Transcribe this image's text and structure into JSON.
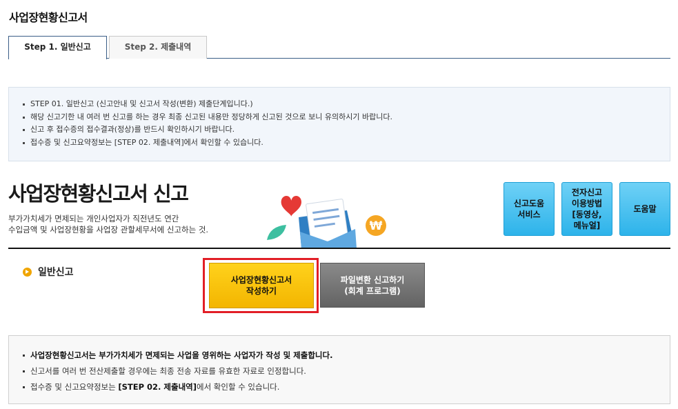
{
  "page": {
    "title": "사업장현황신고서"
  },
  "tabs": [
    {
      "label": "Step 1. 일반신고"
    },
    {
      "label": "Step 2. 제출내역"
    }
  ],
  "info": [
    "STEP 01. 일반신고 (신고안내 및 신고서 작성(변환) 제출단계입니다.)",
    "해당 신고기한 내 여러 번 신고를 하는 경우 최종 신고된 내용만 정당하게 신고된 것으로 보니 유의하시기 바랍니다.",
    "신고 후 접수증의 접수결과(정상)를 반드시 확인하시기 바랍니다.",
    "접수증 및 신고요약정보는 [STEP 02. 제출내역]에서 확인할 수 있습니다."
  ],
  "hero": {
    "title": "사업장현황신고서 신고",
    "desc1": "부가가치세가 면제되는 개인사업자가 직전년도 연간",
    "desc2": "수입금액 및 사업장현황을 사업장 관할세무서에 신고하는 것."
  },
  "help_buttons": {
    "b1_l1": "신고도움",
    "b1_l2": "서비스",
    "b2_l1": "전자신고",
    "b2_l2": "이용방법",
    "b2_l3": "[동영상,",
    "b2_l4": "메뉴얼]",
    "b3_l1": "도움말"
  },
  "section": {
    "label": "일반신고"
  },
  "actions": {
    "write_l1": "사업장현황신고서",
    "write_l2": "작성하기",
    "convert_l1": "파일변환 신고하기",
    "convert_l2": "(회계 프로그램)"
  },
  "notice": {
    "l1_bold1": "사업장현황신고서는",
    "l1_mid": " 부가가치세가 면제되는 ",
    "l1_bold2": "사업을 영위하는 사업자가 작성 및 제출합니다.",
    "l2": "신고서를 여러 번 전산제출할 경우에는 최종 전송 자료를 유효한 자료로 인정합니다.",
    "l3_pre": "접수증 및 신고요약정보는 ",
    "l3_bold": "[STEP 02. 제출내역]",
    "l3_post": "에서 확인할 수 있습니다."
  },
  "colors": {
    "tab_border": "#3a5d86",
    "help_button": "#2db3ea",
    "primary_button": "#f3b500",
    "secondary_button": "#636363",
    "highlight": "#e21e26"
  }
}
